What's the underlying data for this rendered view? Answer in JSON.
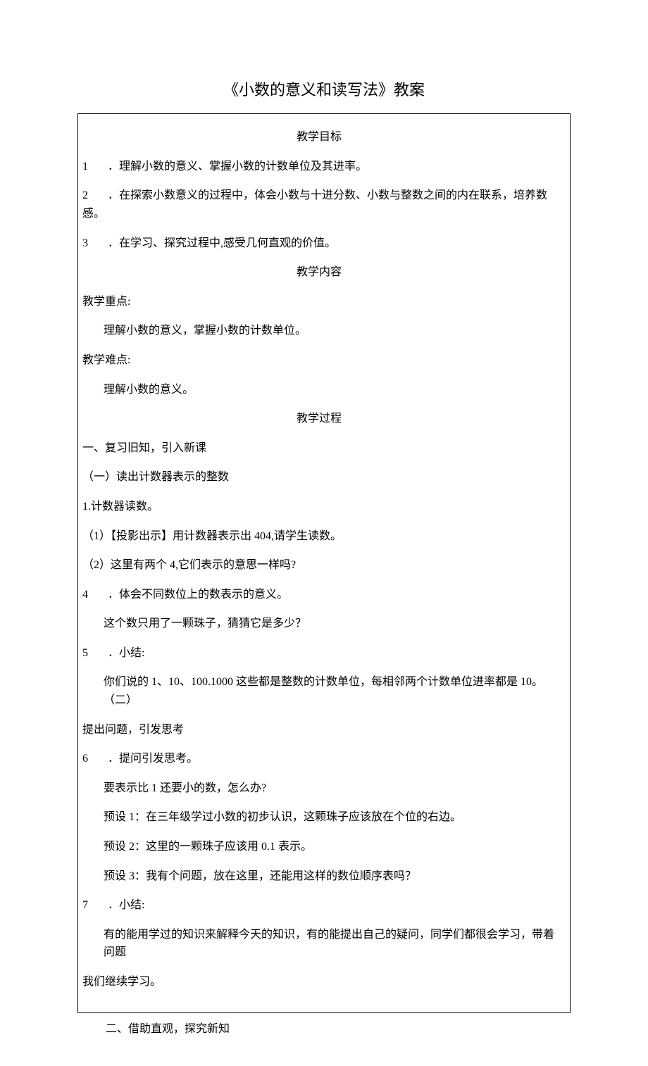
{
  "title": "《小数的意义和读写法》教案",
  "sections": {
    "goals_heading": "教学目标",
    "goals": [
      "．理解小数的意义、掌握小数的计数单位及其进率。",
      "．在探索小数意义的过程中，体会小数与十进分数、小数与整数之间的内在联系，培养数感。",
      "．在学习、探究过程中,感受几何直观的价值。"
    ],
    "content_heading": "教学内容",
    "keypoint_label": "教学重点:",
    "keypoint_text": "理解小数的意义，掌握小数的计数单位。",
    "difficulty_label": "教学难点:",
    "difficulty_text": "理解小数的意义。",
    "process_heading": "教学过程",
    "part1_title": "一、复习旧知，引入新课",
    "part1_sub1": "（一）读出计数器表示的整数",
    "part1_item1": "1.计数器读数。",
    "part1_item1_1": "（1）【投影出示】用计数器表示出 404,请学生读数。",
    "part1_item1_2": "（2）这里有两个 4,它们表示的意思一样吗?",
    "part1_item4_num": "4",
    "part1_item4_text": "．体会不同数位上的数表示的意义。",
    "part1_item4_body": "这个数只用了一颗珠子，猜猜它是多少？",
    "part1_item5_num": "5",
    "part1_item5_text": "．小结:",
    "part1_item5_body": "你们说的 1、10、100.1000 这些都是整数的计数单位，每相邻两个计数单位进率都是 10。 （二）",
    "part1_sub2_tail": "提出问题，引发思考",
    "part1_item6_num": "6",
    "part1_item6_text": "．提问引发思考。",
    "part1_item6_q": "要表示比 1 还要小的数，怎么办?",
    "part1_item6_p1": "预设 1：在三年级学过小数的初步认识，这颗珠子应该放在个位的右边。",
    "part1_item6_p2": "预设 2：这里的一颗珠子应该用 0.1 表示。",
    "part1_item6_p3": "预设 3：我有个问题，放在这里，还能用这样的数位顺序表吗？",
    "part1_item7_num": "7",
    "part1_item7_text": "．小结:",
    "part1_item7_body": "有的能用学过的知识来解释今天的知识，有的能提出自己的疑问，同学们都很会学习，带着问题",
    "part1_item7_body2": "我们继续学习。",
    "outside_line": "二、借助直观，探究新知"
  }
}
